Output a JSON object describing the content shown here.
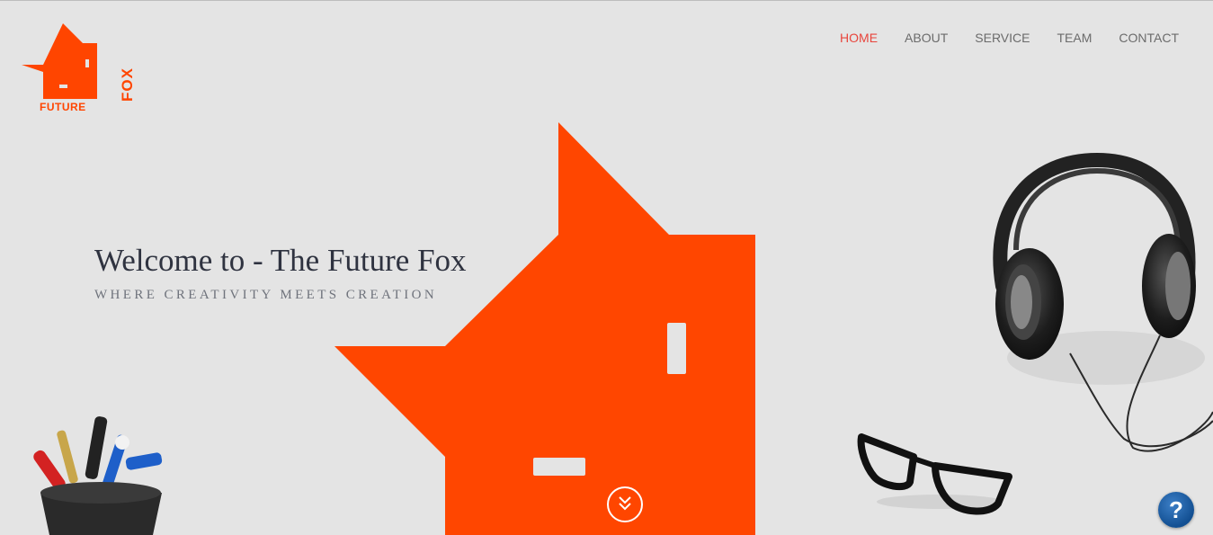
{
  "brand": {
    "logo_top_text": "FOX",
    "logo_bottom_text": "FUTURE",
    "accent_color": "#ff4500"
  },
  "nav": {
    "items": [
      {
        "label": "HOME",
        "active": true
      },
      {
        "label": "ABOUT",
        "active": false
      },
      {
        "label": "SERVICE",
        "active": false
      },
      {
        "label": "TEAM",
        "active": false
      },
      {
        "label": "CONTACT",
        "active": false
      }
    ],
    "active_color": "#e8453c"
  },
  "hero": {
    "title": "Welcome to - The Future Fox",
    "subtitle": "WHERE CREATIVITY MEETS CREATION"
  },
  "scroll_button": {
    "icon": "double-chevron-down-icon"
  },
  "help_button": {
    "label": "?",
    "icon": "help-icon"
  }
}
